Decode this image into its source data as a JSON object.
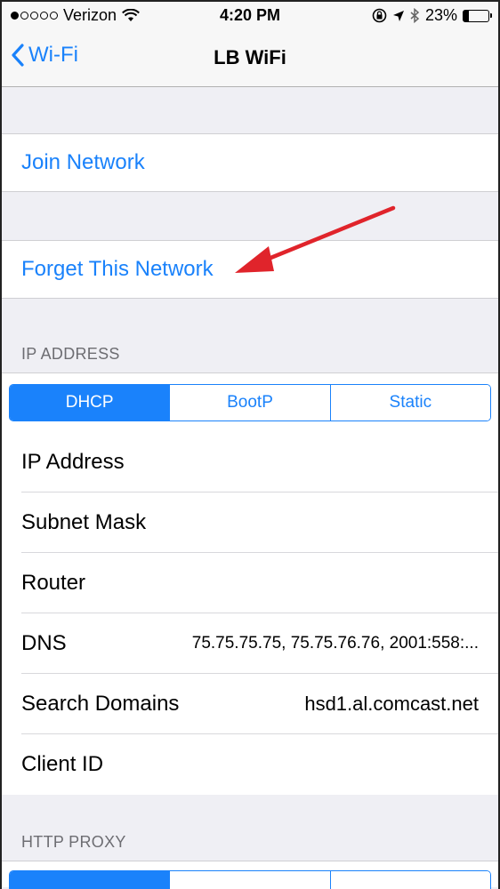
{
  "status_bar": {
    "carrier": "Verizon",
    "time": "4:20 PM",
    "battery": "23%",
    "battery_level": 0.23,
    "signal_dots_filled": 1,
    "icons": [
      "wifi-icon",
      "lock-rotation-icon",
      "location-icon",
      "bluetooth-icon",
      "battery-icon"
    ]
  },
  "nav": {
    "back_label": "Wi-Fi",
    "title": "LB WiFi"
  },
  "actions": {
    "join_network": "Join Network",
    "forget_network": "Forget This Network"
  },
  "ip_section": {
    "header": "IP ADDRESS",
    "segments": [
      "DHCP",
      "BootP",
      "Static"
    ],
    "selected": "DHCP",
    "rows": [
      {
        "label": "IP Address",
        "value": ""
      },
      {
        "label": "Subnet Mask",
        "value": ""
      },
      {
        "label": "Router",
        "value": ""
      },
      {
        "label": "DNS",
        "value": "75.75.75.75, 75.75.76.76, 2001:558:..."
      },
      {
        "label": "Search Domains",
        "value": "hsd1.al.comcast.net"
      },
      {
        "label": "Client ID",
        "value": ""
      }
    ]
  },
  "proxy_section": {
    "header": "HTTP PROXY"
  },
  "colors": {
    "accent": "#1a82fb",
    "annotation_arrow": "#e0242b"
  }
}
